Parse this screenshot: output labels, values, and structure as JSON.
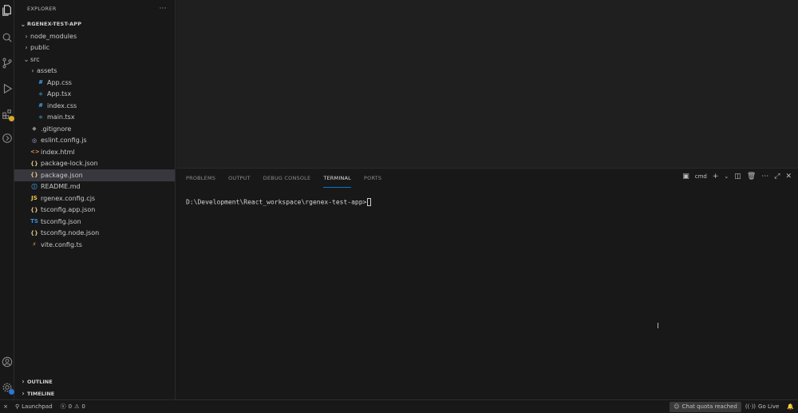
{
  "sidebar": {
    "title": "EXPLORER",
    "more": "···",
    "project": "RGENEX-TEST-APP",
    "tree": [
      {
        "label": "node_modules",
        "depth": 1,
        "chevron": "›",
        "icon": "",
        "icon_name": "folder-icon",
        "color": "#c8c8c8"
      },
      {
        "label": "public",
        "depth": 1,
        "chevron": "›",
        "icon": "",
        "icon_name": "folder-icon",
        "color": "#c8c8c8"
      },
      {
        "label": "src",
        "depth": 1,
        "chevron": "⌄",
        "icon": "",
        "icon_name": "folder-open-icon",
        "color": "#c8c8c8"
      },
      {
        "label": "assets",
        "depth": 2,
        "chevron": "›",
        "icon": "",
        "icon_name": "folder-icon",
        "color": "#c8c8c8"
      },
      {
        "label": "App.css",
        "depth": 2,
        "chevron": "",
        "icon": "#",
        "icon_name": "css-file-icon",
        "color": "#42a5f5"
      },
      {
        "label": "App.tsx",
        "depth": 2,
        "chevron": "",
        "icon": "⚛",
        "icon_name": "react-file-icon",
        "color": "#4fc3f7"
      },
      {
        "label": "index.css",
        "depth": 2,
        "chevron": "",
        "icon": "#",
        "icon_name": "css-file-icon",
        "color": "#42a5f5"
      },
      {
        "label": "main.tsx",
        "depth": 2,
        "chevron": "",
        "icon": "⚛",
        "icon_name": "react-file-icon",
        "color": "#4fc3f7"
      },
      {
        "label": ".gitignore",
        "depth": 1,
        "chevron": "",
        "icon": "◆",
        "icon_name": "git-file-icon",
        "color": "#8a8a8a"
      },
      {
        "label": "eslint.config.js",
        "depth": 1,
        "chevron": "",
        "icon": "◎",
        "icon_name": "eslint-file-icon",
        "color": "#b0b0f0"
      },
      {
        "label": "index.html",
        "depth": 1,
        "chevron": "",
        "icon": "<>",
        "icon_name": "html-file-icon",
        "color": "#e38c5a"
      },
      {
        "label": "package-lock.json",
        "depth": 1,
        "chevron": "",
        "icon": "{}",
        "icon_name": "json-file-icon",
        "color": "#d7ba7d"
      },
      {
        "label": "package.json",
        "depth": 1,
        "chevron": "",
        "icon": "{}",
        "icon_name": "json-file-icon",
        "color": "#d7ba7d",
        "selected": true
      },
      {
        "label": "README.md",
        "depth": 1,
        "chevron": "",
        "icon": "ⓘ",
        "icon_name": "info-file-icon",
        "color": "#42a5f5"
      },
      {
        "label": "rgenex.config.cjs",
        "depth": 1,
        "chevron": "",
        "icon": "JS",
        "icon_name": "js-file-icon",
        "color": "#e8c84a"
      },
      {
        "label": "tsconfig.app.json",
        "depth": 1,
        "chevron": "",
        "icon": "{}",
        "icon_name": "json-file-icon",
        "color": "#d7ba7d"
      },
      {
        "label": "tsconfig.json",
        "depth": 1,
        "chevron": "",
        "icon": "TS",
        "icon_name": "ts-file-icon",
        "color": "#3c8cdc"
      },
      {
        "label": "tsconfig.node.json",
        "depth": 1,
        "chevron": "",
        "icon": "{}",
        "icon_name": "json-file-icon",
        "color": "#d7ba7d"
      },
      {
        "label": "vite.config.ts",
        "depth": 1,
        "chevron": "",
        "icon": "⚡",
        "icon_name": "vite-file-icon",
        "color": "#f0c040"
      }
    ],
    "outline": "OUTLINE",
    "timeline": "TIMELINE"
  },
  "panel": {
    "tabs": [
      "PROBLEMS",
      "OUTPUT",
      "DEBUG CONSOLE",
      "TERMINAL",
      "PORTS"
    ],
    "active_tab": "TERMINAL",
    "terminal_name": "cmd",
    "prompt": "D:\\Development\\React_workspace\\rgenex-test-app>"
  },
  "status": {
    "remote_icon": "⨯",
    "launchpad": "Launchpad",
    "errors": "0",
    "warnings": "0",
    "chat": "Chat quota reached",
    "go_live": "Go Live"
  },
  "colors": {
    "accent": "#0078d4",
    "selected_row": "#37373d",
    "background": "#181818"
  }
}
